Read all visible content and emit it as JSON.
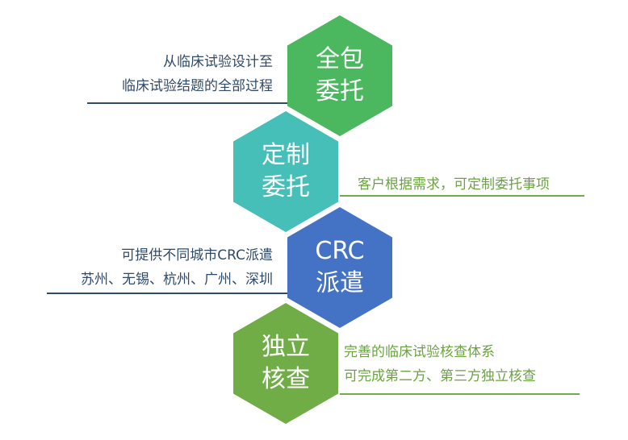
{
  "hexagons": [
    {
      "line1": "全包",
      "line2": "委托",
      "color": "#4bb85f"
    },
    {
      "line1": "定制",
      "line2": "委托",
      "color": "#45bfb8"
    },
    {
      "line1": "CRC",
      "line2": "派遣",
      "color": "#4472c4"
    },
    {
      "line1": "独立",
      "line2": "核查",
      "color": "#70ad47"
    }
  ],
  "labels": [
    {
      "lines": [
        "从临床试验设计至",
        "临床试验结题的全部过程"
      ]
    },
    {
      "lines": [
        "客户根据需求，可定制委托事项"
      ]
    },
    {
      "lines": [
        "可提供不同城市CRC派遣",
        "苏州、无锡、杭州、广州、深圳"
      ]
    },
    {
      "lines": [
        "完善的临床试验核查体系",
        "可完成第二方、第三方独立核查"
      ]
    }
  ]
}
